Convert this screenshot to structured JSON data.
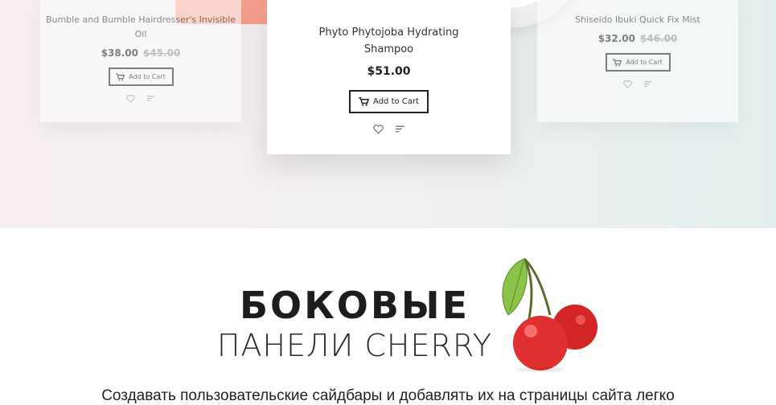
{
  "products": {
    "left": {
      "name": "Bumble and Bumble Hairdresser's Invisible Oil",
      "price": "$38.00",
      "old_price": "$45.00",
      "cart_label": "Add to Cart"
    },
    "center": {
      "name": "Phyto Phytojoba Hydrating Shampoo",
      "price": "$51.00",
      "cart_label": "Add to Cart"
    },
    "right": {
      "name": "Shiseido Ibuki Quick Fix Mist",
      "price": "$32.00",
      "old_price": "$46.00",
      "cart_label": "Add to Cart"
    }
  },
  "promo": {
    "title_line1": "БОКОВЫЕ",
    "title_line2": "ПАНЕЛИ CHERRY",
    "text": "Создавать пользовательские сайдбары и добавлять их на страницы сайта легко"
  },
  "icons": {
    "cart": "cart-icon",
    "wishlist": "heart-icon",
    "compare": "compare-icon",
    "illustration": "cherry-icon"
  },
  "colors": {
    "accent_pink": "#f79e8e",
    "cherry_red": "#d62a2a",
    "leaf_green": "#7cb342",
    "text_dark": "#1d1d1f"
  }
}
